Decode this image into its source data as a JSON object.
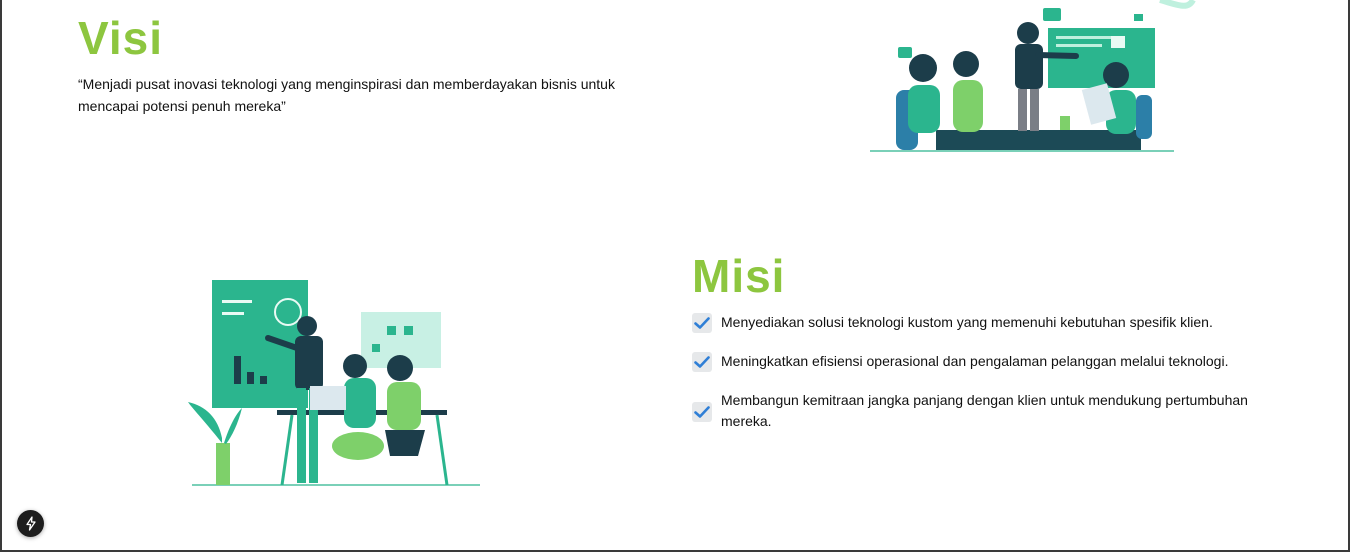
{
  "visi": {
    "title": "Visi",
    "text": "“Menjadi pusat inovasi teknologi yang menginspirasi dan memberdayakan bisnis untuk mencapai potensi penuh mereka”"
  },
  "misi": {
    "title": "Misi",
    "items": [
      "Menyediakan solusi teknologi kustom yang memenuhi kebutuhan spesifik klien.",
      "Meningkatkan efisiensi operasional dan pengalaman pelanggan melalui teknologi.",
      "Membangun kemitraan jangka panjang dengan klien untuk mendukung pertumbuhan mereka."
    ]
  },
  "colors": {
    "heading": "#8dc63f",
    "check": "#2f7fd6",
    "illustration_primary": "#2bb58e",
    "illustration_dark": "#1c3d4a"
  },
  "icons": {
    "checkmark": "check-icon",
    "fab": "lightning-icon"
  }
}
